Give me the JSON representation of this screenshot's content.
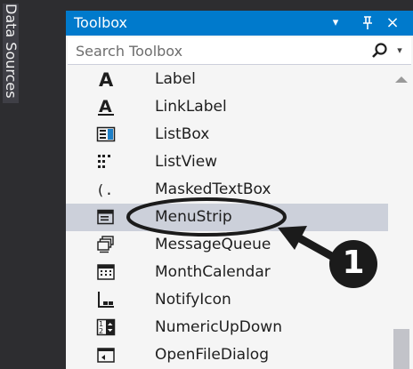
{
  "sidebar": {
    "tab_label": "Data Sources"
  },
  "toolbox": {
    "title": "Toolbox",
    "dropdown_glyph": "▾",
    "pin_glyph": "ᵽ",
    "close_glyph": "×",
    "search": {
      "placeholder": "Search Toolbox",
      "value": ""
    },
    "items": [
      {
        "label": "Label",
        "icon": "label-icon"
      },
      {
        "label": "LinkLabel",
        "icon": "link-label-icon"
      },
      {
        "label": "ListBox",
        "icon": "listbox-icon"
      },
      {
        "label": "ListView",
        "icon": "listview-icon"
      },
      {
        "label": "MaskedTextBox",
        "icon": "masked-textbox-icon"
      },
      {
        "label": "MenuStrip",
        "icon": "menustrip-icon",
        "selected": true
      },
      {
        "label": "MessageQueue",
        "icon": "message-queue-icon"
      },
      {
        "label": "MonthCalendar",
        "icon": "month-calendar-icon"
      },
      {
        "label": "NotifyIcon",
        "icon": "notify-icon"
      },
      {
        "label": "NumericUpDown",
        "icon": "numeric-updown-icon"
      },
      {
        "label": "OpenFileDialog",
        "icon": "open-file-dialog-icon"
      }
    ]
  },
  "annotation": {
    "number": "1",
    "color": "#1b1b1b"
  },
  "colors": {
    "accent": "#007acc",
    "selection": "#ccd0da",
    "panel_bg": "#f5f5f5",
    "ide_bg": "#2d2d30"
  }
}
